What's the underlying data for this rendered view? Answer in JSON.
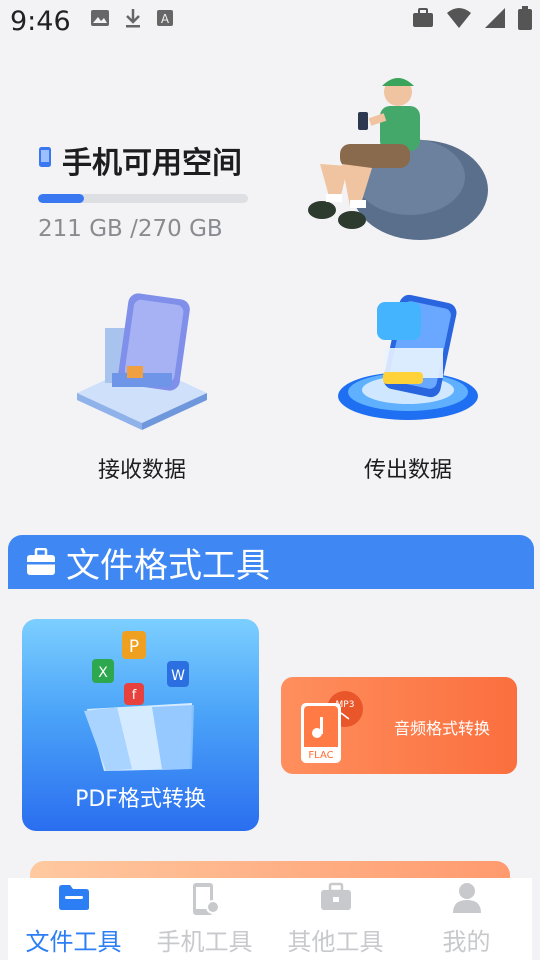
{
  "status_bar": {
    "time": "9:46",
    "left_icons": [
      "image-icon",
      "download-icon",
      "text-a-icon"
    ],
    "right_icons": [
      "briefcase-icon",
      "wifi-icon",
      "signal-icon",
      "battery-icon"
    ]
  },
  "storage": {
    "title": "手机可用空间",
    "used": "211 GB",
    "total": "/270 GB",
    "used_fraction": 0.22
  },
  "transfer": {
    "receive_label": "接收数据",
    "send_label": "传出数据"
  },
  "section": {
    "title": "文件格式工具"
  },
  "tools": {
    "pdf_label": "PDF格式转换",
    "audio_label": "音频格式转换",
    "audio_badge_top": "MP3",
    "audio_badge_bottom": "FLAC"
  },
  "nav": {
    "items": [
      {
        "label": "文件工具",
        "icon": "folder-icon",
        "active": true
      },
      {
        "label": "手机工具",
        "icon": "phone-settings-icon",
        "active": false
      },
      {
        "label": "其他工具",
        "icon": "toolbox-icon",
        "active": false
      },
      {
        "label": "我的",
        "icon": "user-icon",
        "active": false
      }
    ]
  },
  "colors": {
    "accent": "#3f88f4",
    "progress": "#3a78f2",
    "audio_card": "#fb6f3e",
    "nav_active": "#2c7ef5",
    "nav_inactive": "#c8c9cc"
  }
}
